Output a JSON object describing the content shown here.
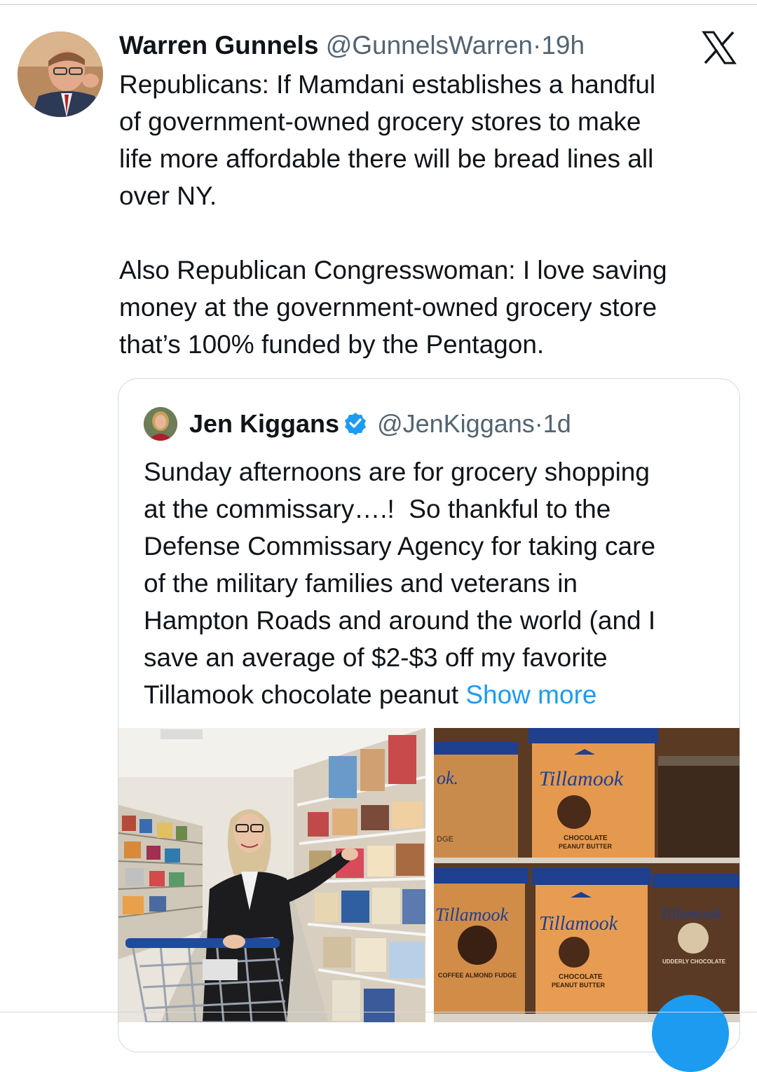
{
  "tweet": {
    "author_name": "Warren Gunnels",
    "handle": "@GunnelsWarren",
    "separator": "·",
    "time": "19h",
    "text": "Republicans: If Mamdani establishes a handful\nof government-owned grocery stores to make\nlife more affordable there will be bread lines all\nover NY.\n\nAlso Republican Congresswoman: I love saving\nmoney at the government-owned grocery store\nthat’s 100% funded by the Pentagon."
  },
  "quoted_tweet": {
    "author_name": "Jen Kiggans",
    "handle": "@JenKiggans",
    "separator": "·",
    "time": "1d",
    "text": "Sunday afternoons are for grocery shopping\nat the commissary….!  So thankful to the\nDefense Commissary Agency for taking care\nof the military families and veterans in\nHampton Roads and around the world (and I\nsave an average of $2-$3 off my favorite\nTillamook chocolate peanut ",
    "show_more_label": "Show more",
    "photos": {
      "left": {
        "content": "woman-in-grocery-aisle-with-cart"
      },
      "right": {
        "content": "tillamook-ice-cream-tubs",
        "labels": {
          "partial_ok": "ok.",
          "brand_1": "Tillamook",
          "flavor_1_line1": "CHOCOLATE",
          "flavor_1_line2": "PEANUT BUTTER",
          "brand_2": "Tillamook",
          "flavor_2": "COFFEE ALMOND FUDGE",
          "brand_3": "Tillamook",
          "flavor_3_line1": "CHOCOLATE",
          "flavor_3_line2": "PEANUT BUTTER",
          "brand_4": "Tillamook",
          "flavor_4": "UDDERLY CHOCOLATE",
          "partial_dge": "DGE"
        }
      }
    }
  },
  "icons": {
    "platform": "x-logo-icon",
    "verified": "verified-badge-icon"
  },
  "colors": {
    "link": "#1d9bf0",
    "secondary_text": "#536471",
    "border": "#cfd9de",
    "tillamook_orange": "#d98a3a",
    "tillamook_blue": "#1f3f8f"
  }
}
